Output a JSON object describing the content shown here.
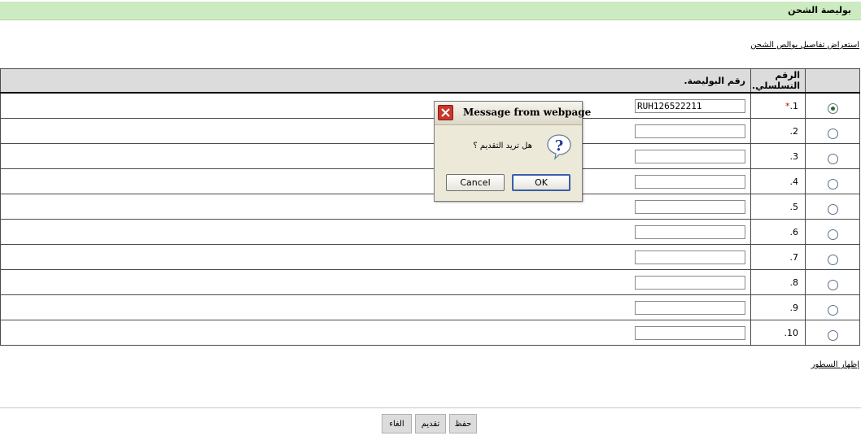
{
  "page": {
    "title": "بوليصة الشحن",
    "details_link": "استعراض تفاصيل بوالص الشحن",
    "show_rows_link": "إظهار السطور"
  },
  "table": {
    "headers": {
      "serial": "الرقم التسلسلي.",
      "policy": "رقم البوليصة."
    },
    "required_mark": "*",
    "rows": [
      {
        "serial": "1.",
        "value": "RUH126522211",
        "selected": true,
        "required": true
      },
      {
        "serial": "2.",
        "value": "",
        "selected": false,
        "required": false
      },
      {
        "serial": "3.",
        "value": "",
        "selected": false,
        "required": false
      },
      {
        "serial": "4.",
        "value": "",
        "selected": false,
        "required": false
      },
      {
        "serial": "5.",
        "value": "",
        "selected": false,
        "required": false
      },
      {
        "serial": "6.",
        "value": "",
        "selected": false,
        "required": false
      },
      {
        "serial": "7.",
        "value": "",
        "selected": false,
        "required": false
      },
      {
        "serial": "8.",
        "value": "",
        "selected": false,
        "required": false
      },
      {
        "serial": "9.",
        "value": "",
        "selected": false,
        "required": false
      },
      {
        "serial": "10.",
        "value": "",
        "selected": false,
        "required": false
      }
    ]
  },
  "footer": {
    "cancel_label": "الغاء",
    "submit_label": "تقديم",
    "save_label": "حفظ"
  },
  "dialog": {
    "title": "Message from webpage",
    "message": "هل تريد التقديم ؟",
    "icon": "question-icon",
    "ok_label": "OK",
    "cancel_label": "Cancel"
  },
  "colors": {
    "title_bar": "#cdebc0",
    "header_row": "#dcdcdc",
    "required": "#d00000",
    "dialog_bg": "#ece9d8",
    "ok_border": "#3a5fa8"
  }
}
